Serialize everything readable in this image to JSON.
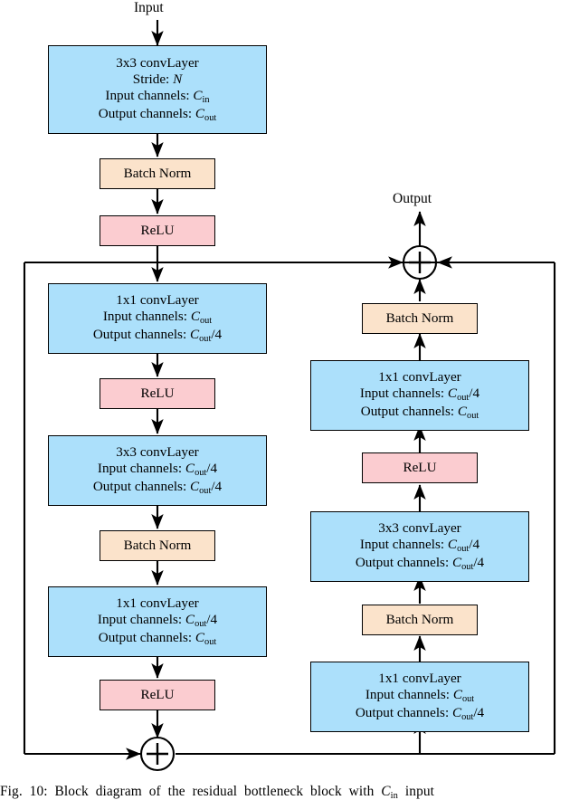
{
  "figure": {
    "labels": {
      "input": "Input",
      "output": "Output"
    },
    "caption": "Fig. 10: Block diagram of the residual bottleneck block with C_in input",
    "colors": {
      "conv": "#ace0fb",
      "batchnorm": "#fbe3cb",
      "relu": "#fbccd0",
      "stroke": "#000000",
      "background": "#ffffff"
    },
    "junction_symbol": "+"
  },
  "nodes": {
    "stem_conv": {
      "type": "conv",
      "lines": [
        "3x3 convLayer",
        "Stride: N",
        "Input channels: C_in",
        "Output channels: C_out"
      ]
    },
    "stem_bn": {
      "type": "batchnorm",
      "lines": [
        "Batch Norm"
      ]
    },
    "stem_relu": {
      "type": "relu",
      "lines": [
        "ReLU"
      ]
    },
    "left_conv1": {
      "type": "conv",
      "lines": [
        "1x1 convLayer",
        "Input channels: C_out",
        "Output channels: C_out/4"
      ]
    },
    "left_relu1": {
      "type": "relu",
      "lines": [
        "ReLU"
      ]
    },
    "left_conv2": {
      "type": "conv",
      "lines": [
        "3x3 convLayer",
        "Input channels: C_out/4",
        "Output channels: C_out/4"
      ]
    },
    "left_bn1": {
      "type": "batchnorm",
      "lines": [
        "Batch Norm"
      ]
    },
    "left_conv3": {
      "type": "conv",
      "lines": [
        "1x1 convLayer",
        "Input channels: C_out/4",
        "Output channels: C_out"
      ]
    },
    "left_relu2": {
      "type": "relu",
      "lines": [
        "ReLU"
      ]
    },
    "right_bn_top": {
      "type": "batchnorm",
      "lines": [
        "Batch Norm"
      ]
    },
    "right_conv_top": {
      "type": "conv",
      "lines": [
        "1x1 convLayer",
        "Input channels: C_out/4",
        "Output channels: C_out"
      ]
    },
    "right_relu": {
      "type": "relu",
      "lines": [
        "ReLU"
      ]
    },
    "right_conv_mid": {
      "type": "conv",
      "lines": [
        "3x3 convLayer",
        "Input channels: C_out/4",
        "Output channels: C_out/4"
      ]
    },
    "right_bn_bottom": {
      "type": "batchnorm",
      "lines": [
        "Batch Norm"
      ]
    },
    "right_conv_bottom": {
      "type": "conv",
      "lines": [
        "1x1 convLayer",
        "Input channels: C_out",
        "Output channels: C_out/4"
      ]
    }
  },
  "chart_data": {
    "type": "diagram",
    "title": "Residual bottleneck block",
    "blocks": [
      {
        "id": "stem_conv",
        "label": "3x3 convLayer",
        "kind": "conv",
        "stride": "N",
        "in_channels": "C_in",
        "out_channels": "C_out"
      },
      {
        "id": "stem_bn",
        "label": "Batch Norm",
        "kind": "batchnorm"
      },
      {
        "id": "stem_relu",
        "label": "ReLU",
        "kind": "relu"
      },
      {
        "id": "left_conv1",
        "label": "1x1 convLayer",
        "kind": "conv",
        "in_channels": "C_out",
        "out_channels": "C_out/4"
      },
      {
        "id": "left_relu1",
        "label": "ReLU",
        "kind": "relu"
      },
      {
        "id": "left_conv2",
        "label": "3x3 convLayer",
        "kind": "conv",
        "in_channels": "C_out/4",
        "out_channels": "C_out/4"
      },
      {
        "id": "left_bn1",
        "label": "Batch Norm",
        "kind": "batchnorm"
      },
      {
        "id": "left_conv3",
        "label": "1x1 convLayer",
        "kind": "conv",
        "in_channels": "C_out/4",
        "out_channels": "C_out"
      },
      {
        "id": "left_relu2",
        "label": "ReLU",
        "kind": "relu"
      },
      {
        "id": "sum_bottom",
        "label": "+",
        "kind": "sum"
      },
      {
        "id": "right_conv_bottom",
        "label": "1x1 convLayer",
        "kind": "conv",
        "in_channels": "C_out",
        "out_channels": "C_out/4"
      },
      {
        "id": "right_bn_bottom",
        "label": "Batch Norm",
        "kind": "batchnorm"
      },
      {
        "id": "right_conv_mid",
        "label": "3x3 convLayer",
        "kind": "conv",
        "in_channels": "C_out/4",
        "out_channels": "C_out/4"
      },
      {
        "id": "right_relu",
        "label": "ReLU",
        "kind": "relu"
      },
      {
        "id": "right_conv_top",
        "label": "1x1 convLayer",
        "kind": "conv",
        "in_channels": "C_out/4",
        "out_channels": "C_out"
      },
      {
        "id": "right_bn_top",
        "label": "Batch Norm",
        "kind": "batchnorm"
      },
      {
        "id": "sum_top",
        "label": "+",
        "kind": "sum"
      }
    ],
    "edges": [
      {
        "from": "Input",
        "to": "stem_conv"
      },
      {
        "from": "stem_conv",
        "to": "stem_bn"
      },
      {
        "from": "stem_bn",
        "to": "stem_relu"
      },
      {
        "from": "stem_relu",
        "to": "left_conv1"
      },
      {
        "from": "stem_relu",
        "to": "sum_bottom",
        "kind": "skip-left"
      },
      {
        "from": "stem_relu",
        "to": "sum_top",
        "kind": "skip-right"
      },
      {
        "from": "left_conv1",
        "to": "left_relu1"
      },
      {
        "from": "left_relu1",
        "to": "left_conv2"
      },
      {
        "from": "left_conv2",
        "to": "left_bn1"
      },
      {
        "from": "left_bn1",
        "to": "left_conv3"
      },
      {
        "from": "left_conv3",
        "to": "left_relu2"
      },
      {
        "from": "left_relu2",
        "to": "sum_bottom"
      },
      {
        "from": "sum_bottom",
        "to": "right_conv_bottom"
      },
      {
        "from": "sum_bottom",
        "to": "sum_top",
        "kind": "skip-right"
      },
      {
        "from": "right_conv_bottom",
        "to": "right_bn_bottom"
      },
      {
        "from": "right_bn_bottom",
        "to": "right_conv_mid"
      },
      {
        "from": "right_conv_mid",
        "to": "right_relu"
      },
      {
        "from": "right_relu",
        "to": "right_conv_top"
      },
      {
        "from": "right_conv_top",
        "to": "right_bn_top"
      },
      {
        "from": "right_bn_top",
        "to": "sum_top"
      },
      {
        "from": "sum_top",
        "to": "Output"
      }
    ]
  }
}
